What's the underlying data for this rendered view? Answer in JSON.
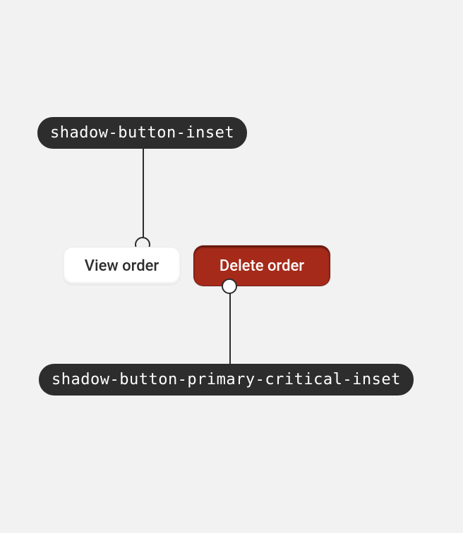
{
  "tokens": {
    "top": "shadow-button-inset",
    "bottom": "shadow-button-primary-critical-inset"
  },
  "buttons": {
    "view": "View order",
    "delete": "Delete order"
  }
}
